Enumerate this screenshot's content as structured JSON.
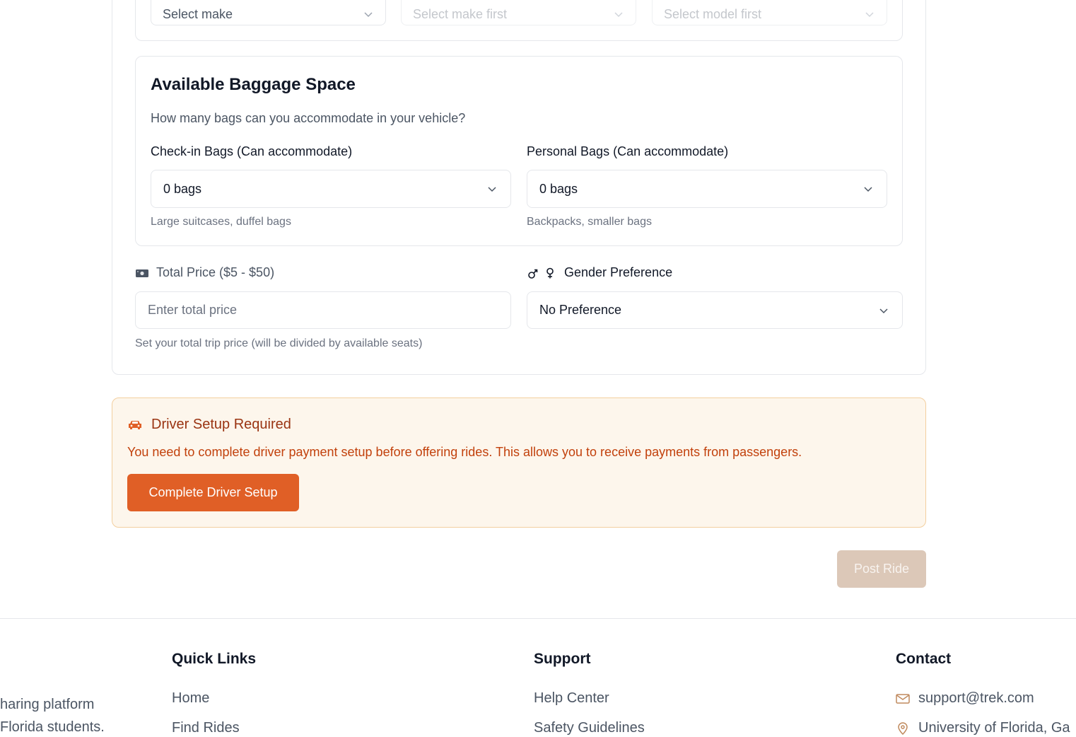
{
  "vehicle": {
    "make_placeholder": "Select make",
    "model_placeholder": "Select make first",
    "year_placeholder": "Select model first"
  },
  "baggage": {
    "title": "Available Baggage Space",
    "subtitle": "How many bags can you accommodate in your vehicle?",
    "checkin_label": "Check-in Bags (Can accommodate)",
    "checkin_value": "0 bags",
    "checkin_hint": "Large suitcases, duffel bags",
    "personal_label": "Personal Bags (Can accommodate)",
    "personal_value": "0 bags",
    "personal_hint": "Backpacks, smaller bags"
  },
  "price": {
    "label": "Total Price ($5 - $50)",
    "placeholder": "Enter total price",
    "hint": "Set your total trip price (will be divided by available seats)",
    "icon": "money-icon"
  },
  "gender": {
    "label": "Gender Preference",
    "value": "No Preference",
    "icon": "gender-icon"
  },
  "alert": {
    "title": "Driver Setup Required",
    "message": "You need to complete driver payment setup before offering rides. This allows you to receive payments from passengers.",
    "button_label": "Complete Driver Setup",
    "icon": "car-icon",
    "accent": "#e05f26"
  },
  "post_button_label": "Post Ride",
  "footer": {
    "description_line1": "haring platform",
    "description_line2": "Florida students.",
    "quick_links": {
      "heading": "Quick Links",
      "items": [
        "Home",
        "Find Rides"
      ]
    },
    "support": {
      "heading": "Support",
      "items": [
        "Help Center",
        "Safety Guidelines"
      ]
    },
    "contact": {
      "heading": "Contact",
      "email": "support@trek.com",
      "location": "University of Florida, Ga"
    }
  }
}
